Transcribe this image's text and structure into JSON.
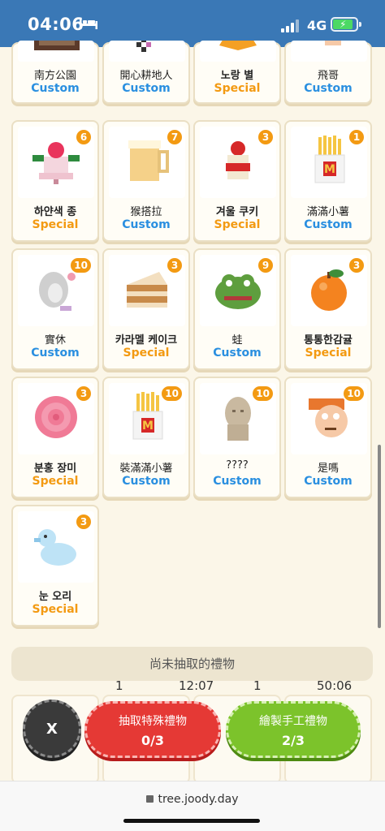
{
  "status": {
    "time": "04:06",
    "network": "4G"
  },
  "top_row": [
    {
      "name": "南方公園",
      "type": "Custom"
    },
    {
      "name": "開心耕地人",
      "type": "Custom"
    },
    {
      "name": "노랑 별",
      "type": "Special"
    },
    {
      "name": "飛哥",
      "type": "Custom"
    }
  ],
  "gifts": [
    {
      "name": "하얀색 종",
      "type": "Special",
      "count": "6",
      "icon": "white-bell-icon"
    },
    {
      "name": "猴搭拉",
      "type": "Custom",
      "count": "7",
      "icon": "beer-mug-icon"
    },
    {
      "name": "겨울 쿠키",
      "type": "Special",
      "count": "3",
      "icon": "winter-cookie-icon"
    },
    {
      "name": "滿滿小薯",
      "type": "Custom",
      "count": "1",
      "icon": "french-fries-icon"
    },
    {
      "name": "實休",
      "type": "Custom",
      "count": "10",
      "icon": "sketch-portrait-icon"
    },
    {
      "name": "카라멜 케이크",
      "type": "Special",
      "count": "3",
      "icon": "caramel-cake-icon"
    },
    {
      "name": "蛙",
      "type": "Custom",
      "count": "9",
      "icon": "frog-icon"
    },
    {
      "name": "통통한감귤",
      "type": "Special",
      "count": "3",
      "icon": "tangerine-icon"
    },
    {
      "name": "분홍 장미",
      "type": "Special",
      "count": "3",
      "icon": "pink-rose-icon"
    },
    {
      "name": "裝滿滿小薯",
      "type": "Custom",
      "count": "10",
      "icon": "french-fries-icon"
    },
    {
      "name": "????",
      "type": "Custom",
      "count": "10",
      "icon": "statue-head-icon"
    },
    {
      "name": "是嗎",
      "type": "Custom",
      "count": "10",
      "icon": "cartoon-face-icon"
    },
    {
      "name": "눈 오리",
      "type": "Special",
      "count": "3",
      "icon": "snow-duck-icon"
    }
  ],
  "not_drawn_label": "尚未抽取的禮物",
  "timers": {
    "left_count": "1",
    "left_time": "12:07",
    "right_count": "1",
    "right_time": "50:06"
  },
  "buttons": {
    "close": "X",
    "draw_special": {
      "label": "抽取特殊禮物",
      "progress": "0/3"
    },
    "draw_custom": {
      "label": "繪製手工禮物",
      "progress": "2/3"
    }
  },
  "url": "tree.joody.day",
  "colors": {
    "status_bar": "#3A78B6",
    "custom": "#2A8FE0",
    "special": "#F39A12",
    "badge": "#F39A12",
    "red_button": "#E53935",
    "green_button": "#7CC32B"
  }
}
